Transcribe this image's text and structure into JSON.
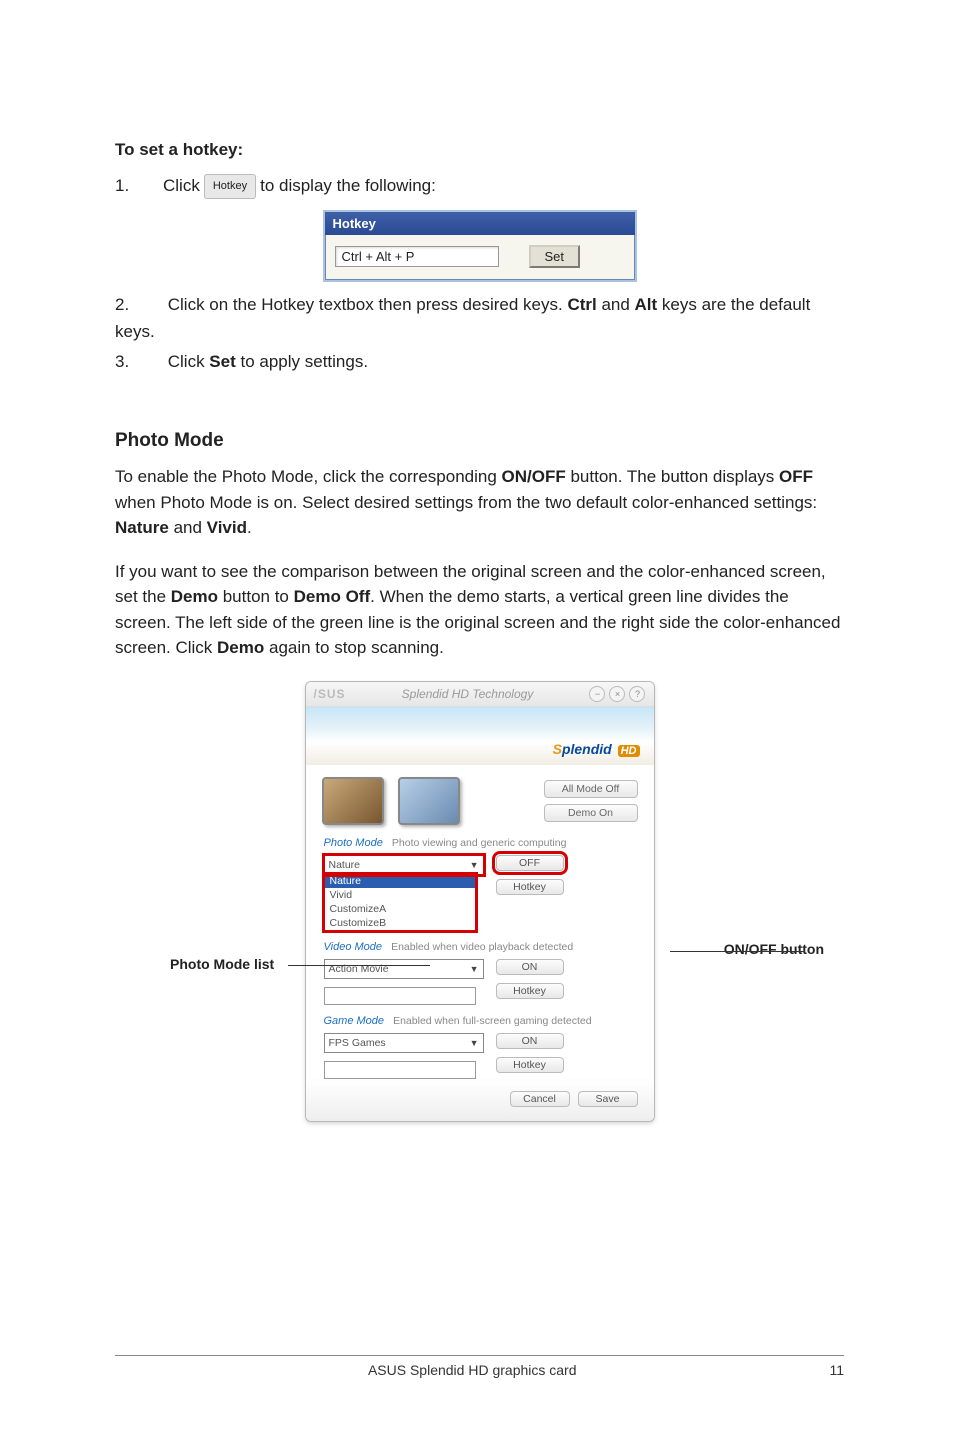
{
  "section1": {
    "heading": "To set a hotkey:",
    "step1_num": "1.",
    "step1_a": "Click",
    "hotkey_button_label": "Hotkey",
    "step1_b": "to display the following:",
    "dialog": {
      "title": "Hotkey",
      "textbox_value": "Ctrl + Alt + P",
      "set_button": "Set"
    },
    "step2_num": "2.",
    "step2_a": "Click on the Hotkey textbox then press desired keys. ",
    "step2_b1": "Ctrl",
    "step2_mid": " and ",
    "step2_b2": "Alt",
    "step2_c": " keys are the default keys.",
    "step3_num": "3.",
    "step3_a": "Click ",
    "step3_b": "Set",
    "step3_c": " to apply settings."
  },
  "photo": {
    "title": "Photo Mode",
    "p1_a": "To enable the Photo Mode, click the corresponding ",
    "p1_b": "ON/OFF",
    "p1_c": " button. The button displays ",
    "p1_d": "OFF",
    "p1_e": " when Photo Mode is on. Select desired settings from the two default color-enhanced settings: ",
    "p1_f": "Nature",
    "p1_g": " and ",
    "p1_h": "Vivid",
    "p1_i": ".",
    "p2_a": "If you want to see the comparison between the original screen and the color-enhanced screen, set the ",
    "p2_b": "Demo",
    "p2_c": " button to ",
    "p2_d": "Demo Off",
    "p2_e": ". When the demo starts, a vertical green line divides the screen. The left side of the green line is the original screen and the right side the color-enhanced screen. Click ",
    "p2_f": "Demo",
    "p2_g": " again to stop scanning."
  },
  "app": {
    "brand": "/SUS",
    "title": "Splendid HD Technology",
    "logo_text_s": "S",
    "logo_text_rest": "plendid ",
    "logo_hd": "HD",
    "btn_allmodeoff": "All Mode Off",
    "btn_demoon": "Demo On",
    "photo_label": "Photo Mode",
    "photo_desc": "Photo viewing and generic computing",
    "photo_value": "Nature",
    "photo_options": [
      "Nature",
      "Vivid",
      "CustomizeA",
      "CustomizeB"
    ],
    "photo_off": "OFF",
    "photo_hotkey": "Hotkey",
    "video_label": "Video Mode",
    "video_desc": "Enabled when video playback detected",
    "video_value": "Action Movie",
    "video_on": "ON",
    "video_hotkey": "Hotkey",
    "game_label": "Game Mode",
    "game_desc": "Enabled when full-screen gaming detected",
    "game_value": "FPS Games",
    "game_on": "ON",
    "game_hotkey": "Hotkey",
    "cancel": "Cancel",
    "save": "Save"
  },
  "callouts": {
    "left": "Photo Mode list",
    "right": "ON/OFF button"
  },
  "footer": {
    "center": "ASUS Splendid HD graphics card",
    "page": "11"
  }
}
